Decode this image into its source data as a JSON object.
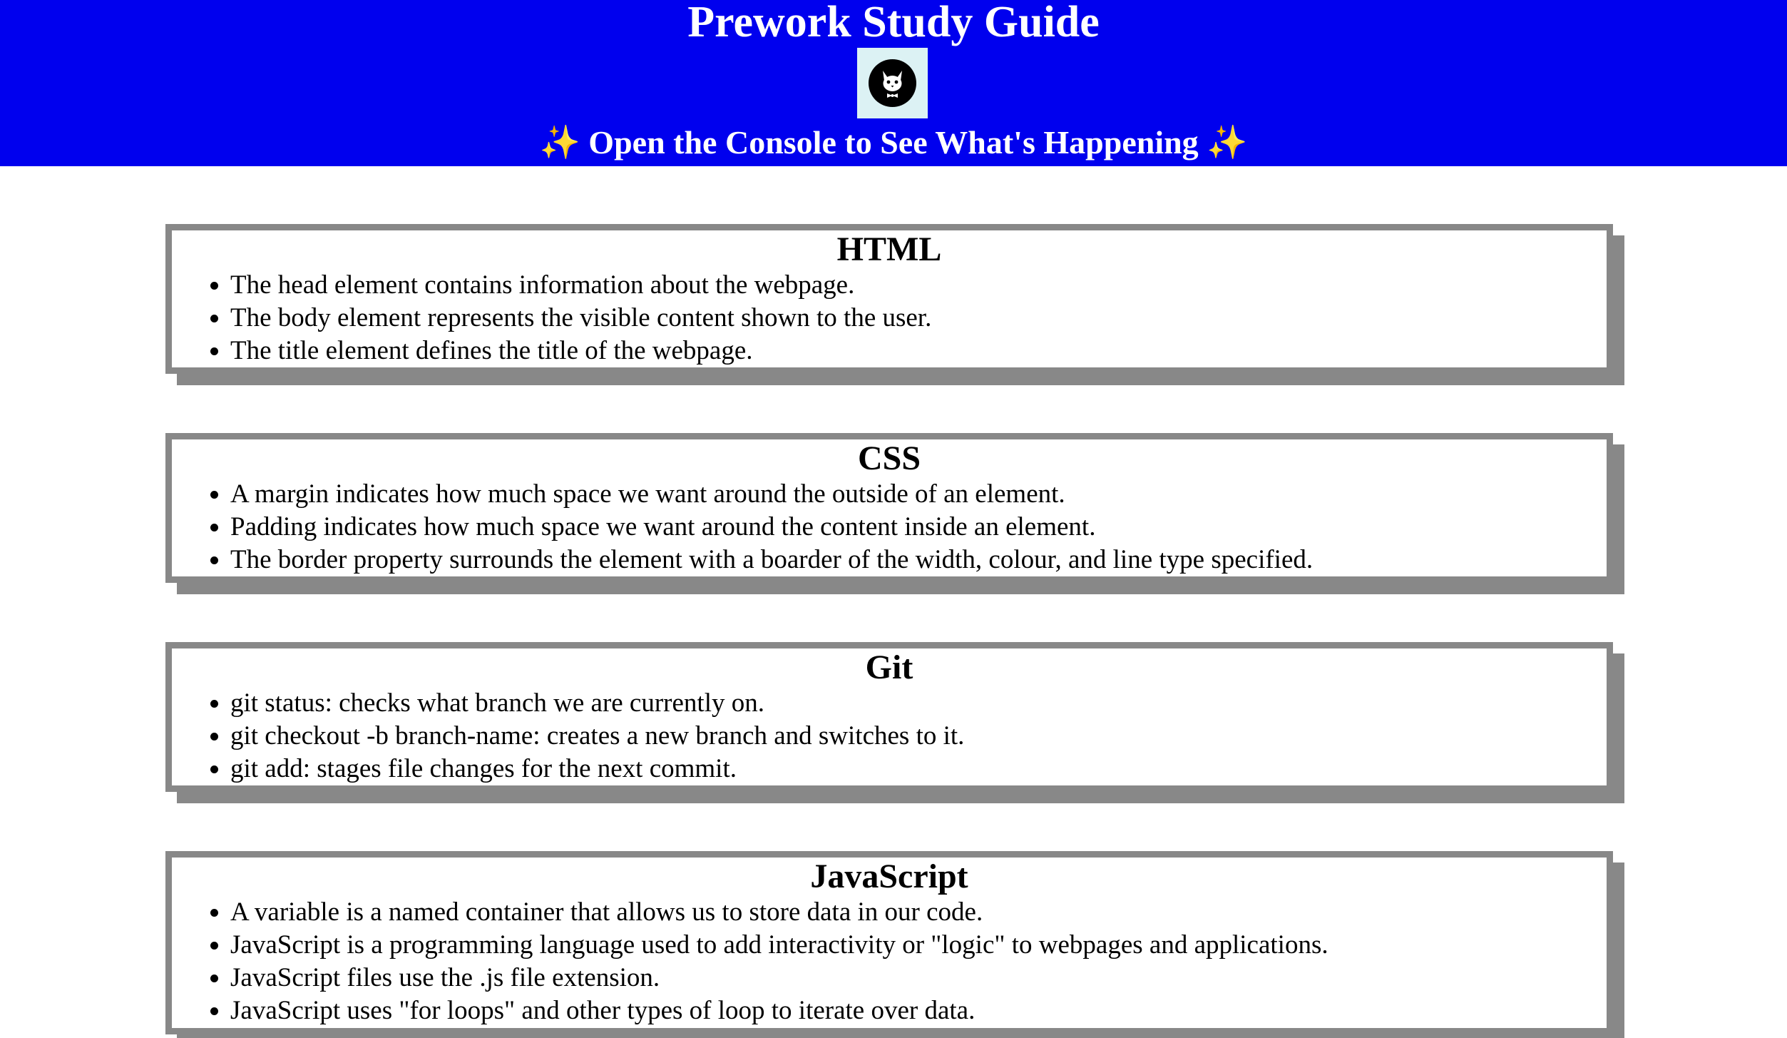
{
  "header": {
    "title": "Prework Study Guide",
    "subtitle": "Open the Console to See What's Happening",
    "sparkle_icon": "✨",
    "logo_icon": "cat-logo-icon",
    "background_color": "#0000ee"
  },
  "sections": [
    {
      "heading": "HTML",
      "items": [
        "The head element contains information about the webpage.",
        "The body element represents the visible content shown to the user.",
        "The title element defines the title of the webpage."
      ]
    },
    {
      "heading": "CSS",
      "items": [
        "A margin indicates how much space we want around the outside of an element.",
        "Padding indicates how much space we want around the content inside an element.",
        "The border property surrounds the element with a boarder of the width, colour, and line type specified."
      ]
    },
    {
      "heading": "Git",
      "items": [
        "git status: checks what branch we are currently on.",
        "git checkout -b branch-name: creates a new branch and switches to it.",
        "git add: stages file changes for the next commit."
      ]
    },
    {
      "heading": "JavaScript",
      "items": [
        "A variable is a named container that allows us to store data in our code.",
        "JavaScript is a programming language used to add interactivity or \"logic\" to webpages and applications.",
        "JavaScript files use the .js file extension.",
        "JavaScript uses \"for loops\" and other types of loop to iterate over data."
      ]
    }
  ]
}
